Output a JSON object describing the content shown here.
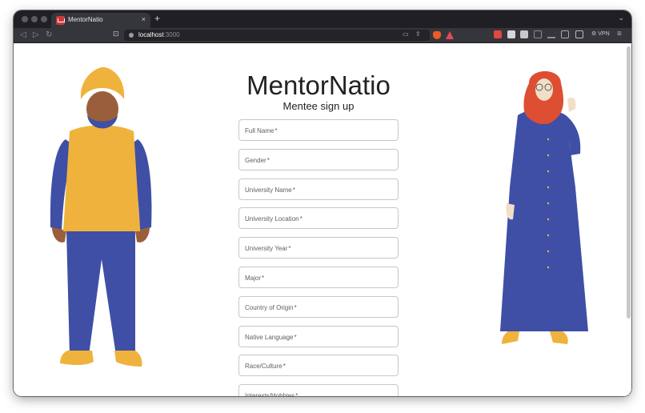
{
  "browser": {
    "tab_title": "MentorNatio",
    "tab_close": "×",
    "new_tab": "+",
    "tab_list_chevron": "⌄",
    "url_host": "localhost",
    "url_port": ":3000",
    "vpn_label": "VPN",
    "menu_glyph": "≡",
    "nav": {
      "back": "◁",
      "forward": "▷",
      "reload": "↻",
      "bookmark": "⊡"
    }
  },
  "page": {
    "brand": "MentorNatio",
    "subtitle": "Mentee sign up",
    "fields": [
      "Full Name",
      "Gender",
      "University Name",
      "University Location",
      "University Year",
      "Major",
      "Country of Origin",
      "Native Language",
      "Race/Culture",
      "Interests/Hobbies"
    ],
    "required_mark": "*"
  },
  "colors": {
    "tabbar_bg": "#1f1f24",
    "toolbar_bg": "#35353c",
    "figure_blue": "#3f4fa5",
    "figure_yellow": "#efb23c",
    "figure_skin_dark": "#9a5f3a",
    "figure_hijab": "#dd4e33",
    "figure_skin_light": "#f1dfc7"
  },
  "icons": {
    "bookmark": "bookmark-icon",
    "site_info": "site-info-icon",
    "brave_shield": "brave-shield-icon",
    "rewards": "brave-rewards-icon"
  }
}
